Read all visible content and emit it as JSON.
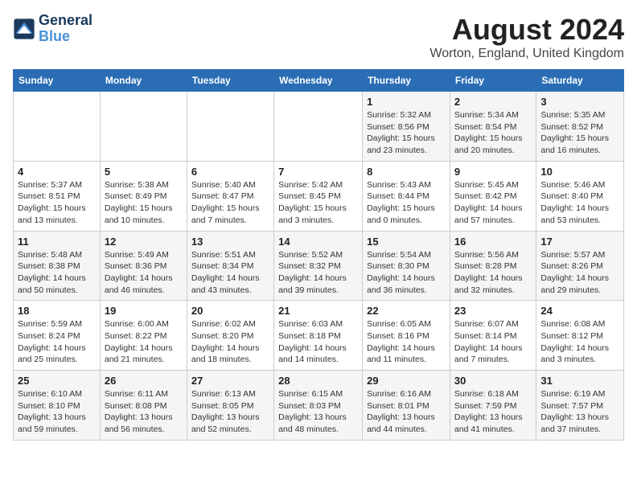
{
  "header": {
    "logo_line1": "General",
    "logo_line2": "Blue",
    "title": "August 2024",
    "subtitle": "Worton, England, United Kingdom"
  },
  "weekdays": [
    "Sunday",
    "Monday",
    "Tuesday",
    "Wednesday",
    "Thursday",
    "Friday",
    "Saturday"
  ],
  "weeks": [
    [
      {
        "day": "",
        "info": ""
      },
      {
        "day": "",
        "info": ""
      },
      {
        "day": "",
        "info": ""
      },
      {
        "day": "",
        "info": ""
      },
      {
        "day": "1",
        "info": "Sunrise: 5:32 AM\nSunset: 8:56 PM\nDaylight: 15 hours\nand 23 minutes."
      },
      {
        "day": "2",
        "info": "Sunrise: 5:34 AM\nSunset: 8:54 PM\nDaylight: 15 hours\nand 20 minutes."
      },
      {
        "day": "3",
        "info": "Sunrise: 5:35 AM\nSunset: 8:52 PM\nDaylight: 15 hours\nand 16 minutes."
      }
    ],
    [
      {
        "day": "4",
        "info": "Sunrise: 5:37 AM\nSunset: 8:51 PM\nDaylight: 15 hours\nand 13 minutes."
      },
      {
        "day": "5",
        "info": "Sunrise: 5:38 AM\nSunset: 8:49 PM\nDaylight: 15 hours\nand 10 minutes."
      },
      {
        "day": "6",
        "info": "Sunrise: 5:40 AM\nSunset: 8:47 PM\nDaylight: 15 hours\nand 7 minutes."
      },
      {
        "day": "7",
        "info": "Sunrise: 5:42 AM\nSunset: 8:45 PM\nDaylight: 15 hours\nand 3 minutes."
      },
      {
        "day": "8",
        "info": "Sunrise: 5:43 AM\nSunset: 8:44 PM\nDaylight: 15 hours\nand 0 minutes."
      },
      {
        "day": "9",
        "info": "Sunrise: 5:45 AM\nSunset: 8:42 PM\nDaylight: 14 hours\nand 57 minutes."
      },
      {
        "day": "10",
        "info": "Sunrise: 5:46 AM\nSunset: 8:40 PM\nDaylight: 14 hours\nand 53 minutes."
      }
    ],
    [
      {
        "day": "11",
        "info": "Sunrise: 5:48 AM\nSunset: 8:38 PM\nDaylight: 14 hours\nand 50 minutes."
      },
      {
        "day": "12",
        "info": "Sunrise: 5:49 AM\nSunset: 8:36 PM\nDaylight: 14 hours\nand 46 minutes."
      },
      {
        "day": "13",
        "info": "Sunrise: 5:51 AM\nSunset: 8:34 PM\nDaylight: 14 hours\nand 43 minutes."
      },
      {
        "day": "14",
        "info": "Sunrise: 5:52 AM\nSunset: 8:32 PM\nDaylight: 14 hours\nand 39 minutes."
      },
      {
        "day": "15",
        "info": "Sunrise: 5:54 AM\nSunset: 8:30 PM\nDaylight: 14 hours\nand 36 minutes."
      },
      {
        "day": "16",
        "info": "Sunrise: 5:56 AM\nSunset: 8:28 PM\nDaylight: 14 hours\nand 32 minutes."
      },
      {
        "day": "17",
        "info": "Sunrise: 5:57 AM\nSunset: 8:26 PM\nDaylight: 14 hours\nand 29 minutes."
      }
    ],
    [
      {
        "day": "18",
        "info": "Sunrise: 5:59 AM\nSunset: 8:24 PM\nDaylight: 14 hours\nand 25 minutes."
      },
      {
        "day": "19",
        "info": "Sunrise: 6:00 AM\nSunset: 8:22 PM\nDaylight: 14 hours\nand 21 minutes."
      },
      {
        "day": "20",
        "info": "Sunrise: 6:02 AM\nSunset: 8:20 PM\nDaylight: 14 hours\nand 18 minutes."
      },
      {
        "day": "21",
        "info": "Sunrise: 6:03 AM\nSunset: 8:18 PM\nDaylight: 14 hours\nand 14 minutes."
      },
      {
        "day": "22",
        "info": "Sunrise: 6:05 AM\nSunset: 8:16 PM\nDaylight: 14 hours\nand 11 minutes."
      },
      {
        "day": "23",
        "info": "Sunrise: 6:07 AM\nSunset: 8:14 PM\nDaylight: 14 hours\nand 7 minutes."
      },
      {
        "day": "24",
        "info": "Sunrise: 6:08 AM\nSunset: 8:12 PM\nDaylight: 14 hours\nand 3 minutes."
      }
    ],
    [
      {
        "day": "25",
        "info": "Sunrise: 6:10 AM\nSunset: 8:10 PM\nDaylight: 13 hours\nand 59 minutes."
      },
      {
        "day": "26",
        "info": "Sunrise: 6:11 AM\nSunset: 8:08 PM\nDaylight: 13 hours\nand 56 minutes."
      },
      {
        "day": "27",
        "info": "Sunrise: 6:13 AM\nSunset: 8:05 PM\nDaylight: 13 hours\nand 52 minutes."
      },
      {
        "day": "28",
        "info": "Sunrise: 6:15 AM\nSunset: 8:03 PM\nDaylight: 13 hours\nand 48 minutes."
      },
      {
        "day": "29",
        "info": "Sunrise: 6:16 AM\nSunset: 8:01 PM\nDaylight: 13 hours\nand 44 minutes."
      },
      {
        "day": "30",
        "info": "Sunrise: 6:18 AM\nSunset: 7:59 PM\nDaylight: 13 hours\nand 41 minutes."
      },
      {
        "day": "31",
        "info": "Sunrise: 6:19 AM\nSunset: 7:57 PM\nDaylight: 13 hours\nand 37 minutes."
      }
    ]
  ]
}
